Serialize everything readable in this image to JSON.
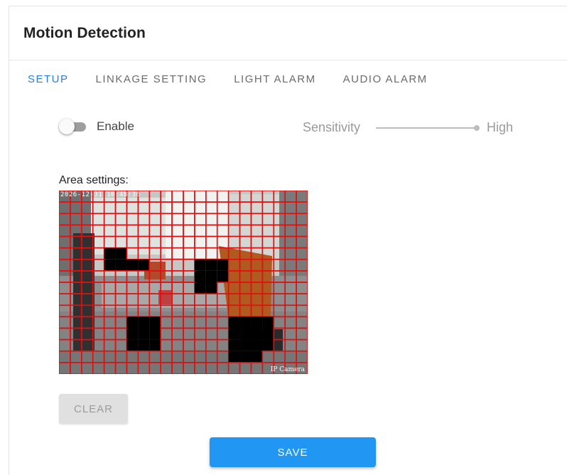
{
  "header": {
    "title": "Motion Detection"
  },
  "tabs": [
    {
      "label": "SETUP",
      "active": true
    },
    {
      "label": "LINKAGE SETTING",
      "active": false
    },
    {
      "label": "LIGHT ALARM",
      "active": false
    },
    {
      "label": "AUDIO ALARM",
      "active": false
    }
  ],
  "enable": {
    "label": "Enable",
    "checked": false
  },
  "sensitivity": {
    "label": "Sensitivity",
    "level_label": "High",
    "value_fraction": 1.0
  },
  "area": {
    "label": "Area settings:",
    "osd_timestamp": "2026-12-31 10:48:36",
    "osd_camera": "IP Camera",
    "grid_cols": 22,
    "grid_rows": 16,
    "grid_color": "#e01010",
    "unselected_cells": [
      [
        4,
        5
      ],
      [
        5,
        5
      ],
      [
        4,
        6
      ],
      [
        5,
        6
      ],
      [
        6,
        6
      ],
      [
        7,
        6
      ],
      [
        12,
        6
      ],
      [
        13,
        6
      ],
      [
        14,
        6
      ],
      [
        12,
        7
      ],
      [
        13,
        7
      ],
      [
        14,
        7
      ],
      [
        12,
        8
      ],
      [
        13,
        8
      ],
      [
        6,
        11
      ],
      [
        7,
        11
      ],
      [
        8,
        11
      ],
      [
        6,
        12
      ],
      [
        7,
        12
      ],
      [
        8,
        12
      ],
      [
        6,
        13
      ],
      [
        7,
        13
      ],
      [
        8,
        13
      ],
      [
        15,
        11
      ],
      [
        16,
        11
      ],
      [
        17,
        11
      ],
      [
        18,
        11
      ],
      [
        15,
        12
      ],
      [
        16,
        12
      ],
      [
        17,
        12
      ],
      [
        18,
        12
      ],
      [
        15,
        13
      ],
      [
        16,
        13
      ],
      [
        17,
        13
      ],
      [
        18,
        13
      ],
      [
        15,
        14
      ],
      [
        16,
        14
      ],
      [
        17,
        14
      ]
    ]
  },
  "buttons": {
    "clear": "CLEAR",
    "save": "SAVE"
  },
  "colors": {
    "accent": "#2b7cd3",
    "save_button": "#2196f3",
    "disabled_button": "#e0e0e0"
  }
}
